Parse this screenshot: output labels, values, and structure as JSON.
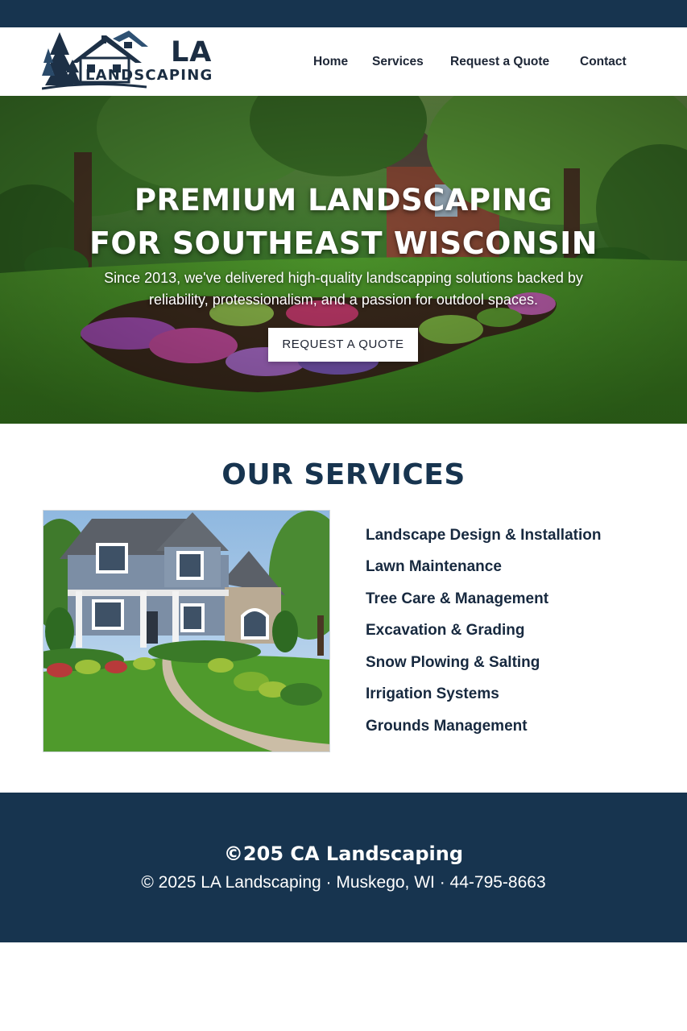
{
  "colors": {
    "navy": "#17344f",
    "white": "#ffffff",
    "text_dark": "#1b2a3d"
  },
  "brand": {
    "logo_la": "LA",
    "logo_word": "LANDSCAPING",
    "logo_icon": "house-trees-logo-icon"
  },
  "nav": {
    "items": [
      {
        "label": "Home"
      },
      {
        "label": "Services"
      },
      {
        "label": "Request a Quote"
      },
      {
        "label": "Contact"
      }
    ]
  },
  "hero": {
    "title_line1": "PREMIUM LANDSCAPING",
    "title_line2": "FOR SOUTHEAST WISCONSIN",
    "subtitle_line1": "Since 2013, we've delivered high-quality landscapping solutions backed by",
    "subtitle_line2": "reliability, protessionalism, and a passion for outdool spaces.",
    "cta_label": "REQUEST A QUOTE"
  },
  "services": {
    "heading": "OUR SERVICES",
    "items": [
      "Landscape Design & Installation",
      "Lawn Maintenance",
      "Tree Care & Management",
      "Excavation & Grading",
      "Snow Plowing & Salting",
      "Irrigation Systems",
      "Grounds Management"
    ]
  },
  "footer": {
    "brand": "©205 CA Landscaping",
    "line": "© 2025 LA Landscaping · Muskego, WI · 44-795-8663"
  }
}
